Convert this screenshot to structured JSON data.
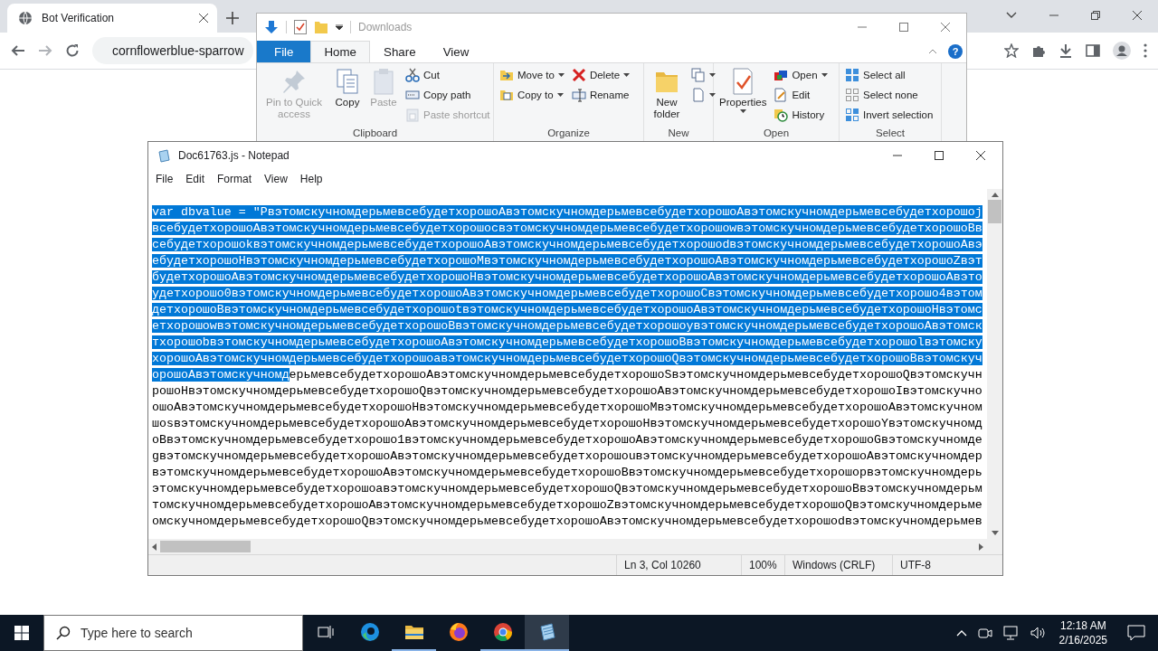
{
  "browser": {
    "tab": {
      "title": "Bot Verification"
    },
    "address": "cornflowerblue-sparrow"
  },
  "explorer": {
    "title": "Downloads",
    "help": "?",
    "tabs": [
      {
        "label": "File",
        "kind": "menu",
        "selected": false
      },
      {
        "label": "Home",
        "kind": "tab",
        "selected": true
      },
      {
        "label": "Share",
        "kind": "tab",
        "selected": false
      },
      {
        "label": "View",
        "kind": "tab",
        "selected": false
      }
    ],
    "ribbon": {
      "groups": [
        {
          "label": "Clipboard",
          "columns": [
            {
              "items": [
                {
                  "kind": "large",
                  "label": "Pin to Quick access",
                  "disabled": true,
                  "dropdown": false
                }
              ]
            },
            {
              "items": [
                {
                  "kind": "large",
                  "label": "Copy",
                  "disabled": false,
                  "dropdown": false
                }
              ]
            },
            {
              "items": [
                {
                  "kind": "large",
                  "label": "Paste",
                  "disabled": true,
                  "dropdown": false
                }
              ]
            },
            {
              "items": [
                {
                  "kind": "small",
                  "label": "Cut",
                  "disabled": false,
                  "dropdown": false
                },
                {
                  "kind": "small",
                  "label": "Copy path",
                  "disabled": false,
                  "dropdown": false
                },
                {
                  "kind": "small",
                  "label": "Paste shortcut",
                  "disabled": true,
                  "dropdown": false
                }
              ]
            }
          ]
        },
        {
          "label": "Organize",
          "columns": [
            {
              "items": [
                {
                  "kind": "small",
                  "label": "Move to",
                  "disabled": false,
                  "dropdown": true
                },
                {
                  "kind": "small",
                  "label": "Copy to",
                  "disabled": false,
                  "dropdown": true
                }
              ]
            },
            {
              "items": [
                {
                  "kind": "small",
                  "label": "Delete",
                  "disabled": false,
                  "dropdown": true
                },
                {
                  "kind": "small",
                  "label": "Rename",
                  "disabled": false,
                  "dropdown": false
                }
              ]
            }
          ]
        },
        {
          "label": "New",
          "columns": [
            {
              "items": [
                {
                  "kind": "large",
                  "label": "New folder",
                  "disabled": false,
                  "dropdown": false
                }
              ]
            },
            {
              "items": [
                {
                  "kind": "icon",
                  "disabled": false,
                  "dropdown": true
                },
                {
                  "kind": "icon",
                  "disabled": false,
                  "dropdown": true
                }
              ]
            }
          ]
        },
        {
          "label": "Open",
          "columns": [
            {
              "items": [
                {
                  "kind": "large",
                  "label": "Properties",
                  "disabled": false,
                  "dropdown": true
                }
              ]
            },
            {
              "items": [
                {
                  "kind": "small",
                  "label": "Open",
                  "disabled": false,
                  "dropdown": true
                },
                {
                  "kind": "small",
                  "label": "Edit",
                  "disabled": false,
                  "dropdown": false
                },
                {
                  "kind": "small",
                  "label": "History",
                  "disabled": false,
                  "dropdown": false
                }
              ]
            }
          ]
        },
        {
          "label": "Select",
          "columns": [
            {
              "items": [
                {
                  "kind": "small",
                  "label": "Select all",
                  "disabled": false,
                  "dropdown": false
                },
                {
                  "kind": "small",
                  "label": "Select none",
                  "disabled": false,
                  "dropdown": false
                },
                {
                  "kind": "small",
                  "label": "Invert selection",
                  "disabled": false,
                  "dropdown": false
                }
              ]
            }
          ]
        }
      ]
    }
  },
  "notepad": {
    "title": "Doc61763.js - Notepad",
    "menu": [
      "File",
      "Edit",
      "Format",
      "View",
      "Help"
    ],
    "lines": [
      {
        "runs": [
          {
            "text": "var dbvalue = \"PвэтомскучномдерьмевсебудетхорошоAвэтомскучномдерьмевсебудетхорошоAвэтомскучномдерьмевсебудетхорошоj",
            "selected": true
          }
        ]
      },
      {
        "runs": [
          {
            "text": "всебудетхорошоAвэтомскучномдерьмевсебудетхорошоcвэтомскучномдерьмевсебудетхорошоwвэтомскучномдерьмевсебудетхорошоBв",
            "selected": true
          }
        ]
      },
      {
        "runs": [
          {
            "text": "себудетхорошоkвэтомскучномдерьмевсебудетхорошоAвэтомскучномдерьмевсебудетхорошоdвэтомскучномдерьмевсебудетхорошоAвэ",
            "selected": true
          }
        ]
      },
      {
        "runs": [
          {
            "text": "ебудетхорошоHвэтомскучномдерьмевсебудетхорошоMвэтомскучномдерьмевсебудетхорошоAвэтомскучномдерьмевсебудетхорошоZвэт",
            "selected": true
          }
        ]
      },
      {
        "runs": [
          {
            "text": "будетхорошоAвэтомскучномдерьмевсебудетхорошоHвэтомскучномдерьмевсебудетхорошоAвэтомскучномдерьмевсебудетхорошоAвэто",
            "selected": true
          }
        ]
      },
      {
        "runs": [
          {
            "text": "удетхорошо0вэтомскучномдерьмевсебудетхорошоAвэтомскучномдерьмевсебудетхорошоCвэтомскучномдерьмевсебудетхорошо4вэтом",
            "selected": true
          }
        ]
      },
      {
        "runs": [
          {
            "text": "детхорошоBвэтомскучномдерьмевсебудетхорошоtвэтомскучномдерьмевсебудетхорошоAвэтомскучномдерьмевсебудетхорошоHвэтомс",
            "selected": true
          }
        ]
      },
      {
        "runs": [
          {
            "text": "етхорошоwвэтомскучномдерьмевсебудетхорошоBвэтомскучномдерьмевсебудетхорошоyвэтомскучномдерьмевсебудетхорошоAвэтомск",
            "selected": true
          }
        ]
      },
      {
        "runs": [
          {
            "text": "тхорошоbвэтомскучномдерьмевсебудетхорошоAвэтомскучномдерьмевсебудетхорошоBвэтомскучномдерьмевсебудетхорошоlвэтомску",
            "selected": true
          }
        ]
      },
      {
        "runs": [
          {
            "text": "хорошоAвэтомскучномдерьмевсебудетхорошоaвэтомскучномдерьмевсебудетхорошоQвэтомскучномдерьмевсебудетхорошоBвэтомскуч",
            "selected": true
          }
        ]
      },
      {
        "runs": [
          {
            "text": "орошоAвэтомскучномд",
            "selected": true
          },
          {
            "text": "ерьмевсебудетхорошоAвэтомскучномдерьмевсебудетхорошоSвэтомскучномдерьмевсебудетхорошоQвэтомскучн",
            "selected": false
          }
        ]
      },
      {
        "runs": [
          {
            "text": "рошоHвэтомскучномдерьмевсебудетхорошоQвэтомскучномдерьмевсебудетхорошоAвэтомскучномдерьмевсебудетхорошоIвэтомскучно",
            "selected": false
          }
        ]
      },
      {
        "runs": [
          {
            "text": "ошоAвэтомскучномдерьмевсебудетхорошоHвэтомскучномдерьмевсебудетхорошоMвэтомскучномдерьмевсебудетхорошоAвэтомскучном",
            "selected": false
          }
        ]
      },
      {
        "runs": [
          {
            "text": "шоsвэтомскучномдерьмевсебудетхорошоAвэтомскучномдерьмевсебудетхорошоHвэтомскучномдерьмевсебудетхорошоYвэтомскучномд",
            "selected": false
          }
        ]
      },
      {
        "runs": [
          {
            "text": "оBвэтомскучномдерьмевсебудетхорошо1вэтомскучномдерьмевсебудетхорошоAвэтомскучномдерьмевсебудетхорошоGвэтомскучномде",
            "selected": false
          }
        ]
      },
      {
        "runs": [
          {
            "text": "gвэтомскучномдерьмевсебудетхорошоAвэтомскучномдерьмевсебудетхорошоuвэтомскучномдерьмевсебудетхорошоAвэтомскучномдер",
            "selected": false
          }
        ]
      },
      {
        "runs": [
          {
            "text": "вэтомскучномдерьмевсебудетхорошоAвэтомскучномдерьмевсебудетхорошоBвэтомскучномдерьмевсебудетхорошоpвэтомскучномдерь",
            "selected": false
          }
        ]
      },
      {
        "runs": [
          {
            "text": "этомскучномдерьмевсебудетхорошоaвэтомскучномдерьмевсебудетхорошоQвэтомскучномдерьмевсебудетхорошоBвэтомскучномдерьм",
            "selected": false
          }
        ]
      },
      {
        "runs": [
          {
            "text": "томскучномдерьмевсебудетхорошоAвэтомскучномдерьмевсебудетхорошоZвэтомскучномдерьмевсебудетхорошоQвэтомскучномдерьме",
            "selected": false
          }
        ]
      },
      {
        "runs": [
          {
            "text": "омскучномдерьмевсебудетхорошоQвэтомскучномдерьмевсебудетхорошоAвэтомскучномдерьмевсебудетхорошоdвэтомскучномдерьмев",
            "selected": false
          }
        ]
      }
    ],
    "status": [
      "Ln 3, Col 10260",
      "100%",
      "Windows (CRLF)",
      "UTF-8"
    ]
  },
  "taskbar": {
    "search": {
      "placeholder": "Type here to search"
    },
    "apps": [
      {
        "running": false,
        "selected": false
      },
      {
        "running": true,
        "selected": false
      },
      {
        "running": false,
        "selected": false
      },
      {
        "running": true,
        "selected": false
      },
      {
        "running": true,
        "selected": true
      }
    ],
    "time": "12:18 AM",
    "date": "2/16/2025"
  }
}
